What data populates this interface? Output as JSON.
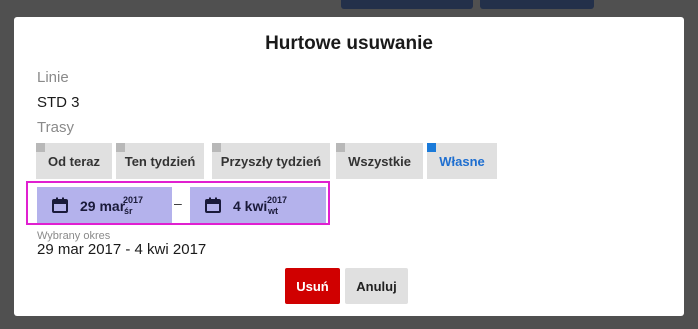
{
  "dialog": {
    "title": "Hurtowe usuwanie",
    "lines_label": "Linie",
    "lines_value": "STD 3",
    "routes_label": "Trasy",
    "filter_tabs": [
      {
        "label": "Od teraz",
        "active": false
      },
      {
        "label": "Ten tydzień",
        "active": false
      },
      {
        "label": "Przyszły tydzień",
        "active": false
      },
      {
        "label": "Wszystkie",
        "active": false
      },
      {
        "label": "Własne",
        "active": true
      }
    ],
    "range": {
      "start": {
        "date": "29 mar",
        "year": "2017",
        "weekday": "śr"
      },
      "separator": "–",
      "end": {
        "date": "4 kwi",
        "year": "2017",
        "weekday": "wt"
      }
    },
    "selected_period_label": "Wybrany okres",
    "selected_period_value": "29 mar 2017 - 4 kwi 2017",
    "delete_button": "Usuń",
    "cancel_button": "Anuluj"
  },
  "colors": {
    "accent_blue": "#1f6fd0",
    "danger_red": "#d00000",
    "date_chip": "#b4b2ec",
    "highlight_border": "#e020d0"
  },
  "icons": [
    "calendar-icon"
  ]
}
